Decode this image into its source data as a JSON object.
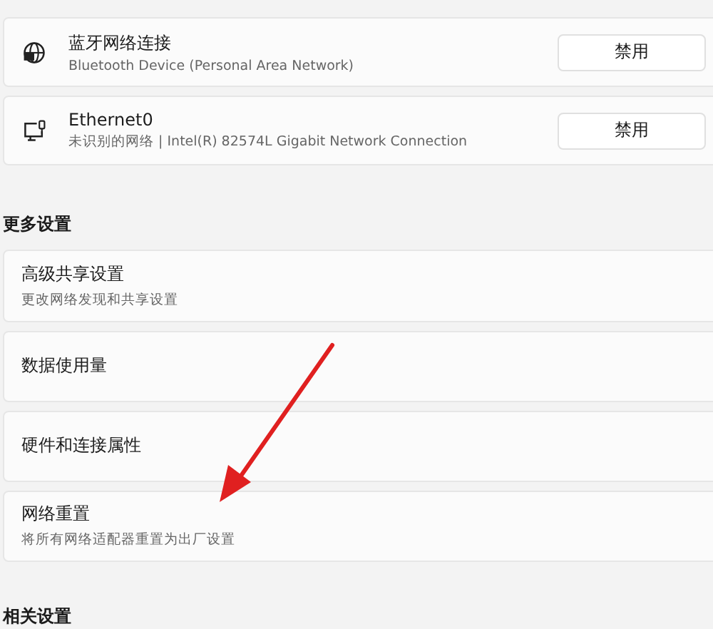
{
  "adapters": [
    {
      "kind": "bluetooth",
      "name": "蓝牙网络连接",
      "description": "Bluetooth Device (Personal Area Network)",
      "button": "禁用"
    },
    {
      "kind": "ethernet",
      "name": "Ethernet0",
      "description": "未识别的网络 | Intel(R) 82574L Gigabit Network Connection",
      "button": "禁用"
    }
  ],
  "more_settings": {
    "heading": "更多设置",
    "items": [
      {
        "title": "高级共享设置",
        "description": "更改网络发现和共享设置"
      },
      {
        "title": "数据使用量"
      },
      {
        "title": "硬件和连接属性"
      },
      {
        "title": "网络重置",
        "description": "将所有网络适配器重置为出厂设置"
      }
    ]
  },
  "related_settings": {
    "heading": "相关设置"
  }
}
